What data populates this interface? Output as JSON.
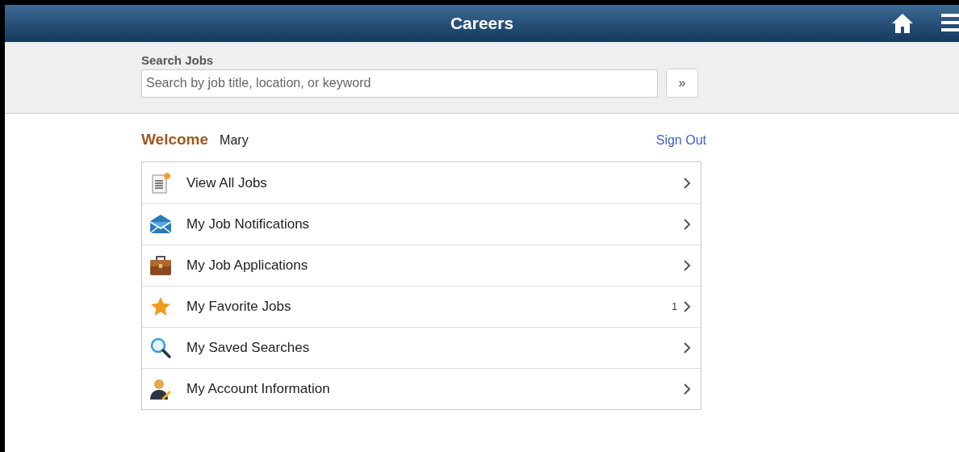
{
  "header": {
    "title": "Careers"
  },
  "search": {
    "label": "Search Jobs",
    "placeholder": "Search by job title, location, or keyword",
    "button": "»"
  },
  "welcome": {
    "label": "Welcome",
    "name": "Mary",
    "sign_out": "Sign Out"
  },
  "menu": [
    {
      "kind": "document",
      "label": "View All Jobs"
    },
    {
      "kind": "envelope",
      "label": "My Job Notifications"
    },
    {
      "kind": "briefcase",
      "label": "My Job Applications"
    },
    {
      "kind": "star",
      "label": "My Favorite Jobs",
      "count": "1"
    },
    {
      "kind": "magnifier",
      "label": "My Saved Searches"
    },
    {
      "kind": "person",
      "label": "My Account Information"
    }
  ]
}
